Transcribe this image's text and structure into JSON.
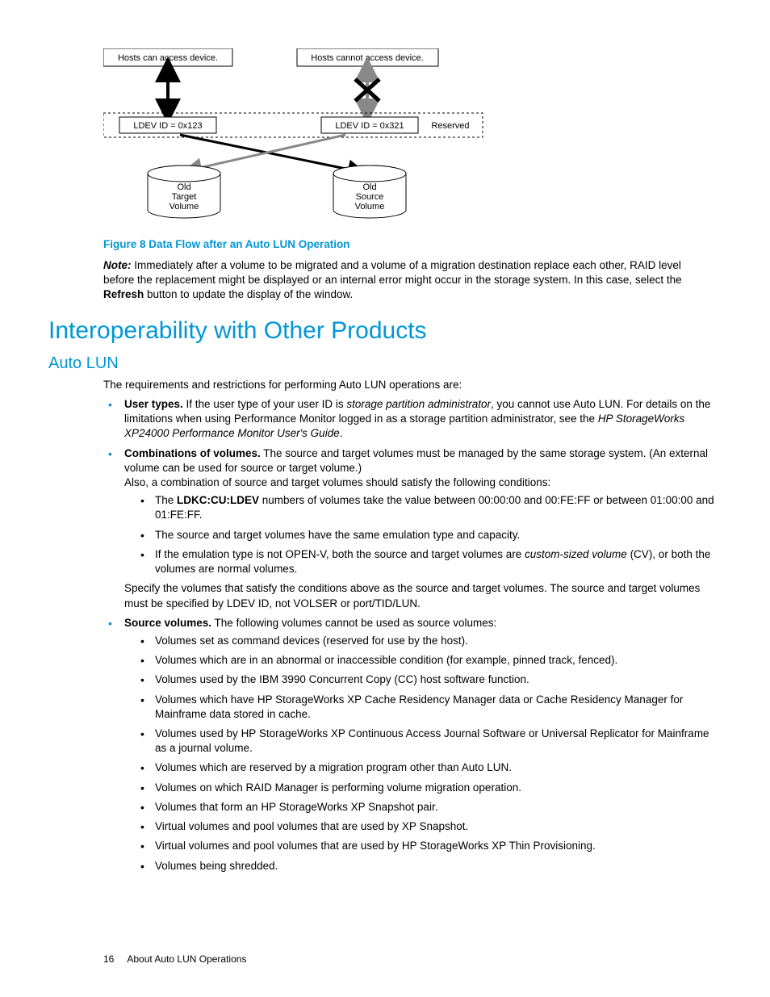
{
  "diagram": {
    "box_hosts_can": "Hosts can access device.",
    "box_hosts_cannot": "Hosts cannot access device.",
    "ldev_left": "LDEV ID = 0x123",
    "ldev_right": "LDEV ID = 0x321",
    "reserved": "Reserved",
    "cyl_left_l1": "Old",
    "cyl_left_l2": "Target",
    "cyl_left_l3": "Volume",
    "cyl_right_l1": "Old",
    "cyl_right_l2": "Source",
    "cyl_right_l3": "Volume"
  },
  "figure_caption": "Figure 8 Data Flow after an Auto LUN Operation",
  "note": {
    "label": "Note:",
    "text_a": " Immediately after a volume to be migrated and a volume of a migration destination replace each other, RAID level before the replacement might be displayed or an internal error might occur in the storage system. In this case, select the ",
    "refresh": "Refresh",
    "text_b": " button to update the display of the window."
  },
  "h1": "Interoperability with Other Products",
  "h2": "Auto LUN",
  "intro": "The requirements and restrictions for performing Auto LUN operations are:",
  "li1": {
    "lead": "User types.",
    "t1": " If the user type of your user ID is ",
    "i1": "storage partition administrator",
    "t2": ", you cannot use Auto LUN. For details on the limitations when using Performance Monitor logged in as a storage partition administrator, see the ",
    "i2": "HP StorageWorks XP24000 Performance Monitor User's Guide",
    "t3": "."
  },
  "li2": {
    "lead": "Combinations of volumes.",
    "t1": " The source and target volumes must be managed by the same storage system. (An external volume can be used for source or target volume.)",
    "t2": "Also, a combination of source and target volumes should satisfy the following conditions:",
    "sub1_a": "The ",
    "sub1_b": "LDKC:CU:LDEV",
    "sub1_c": " numbers of volumes take the value between 00:00:00 and 00:FE:FF or between 01:00:00 and 01:FE:FF.",
    "sub2": "The source and target volumes have the same emulation type and capacity.",
    "sub3_a": "If the emulation type is not OPEN-V, both the source and target volumes are ",
    "sub3_b": "custom-sized volume",
    "sub3_c": " (CV), or both the volumes are normal volumes.",
    "post": "Specify the volumes that satisfy the conditions above as the source and target volumes. The source and target volumes must be specified by LDEV ID, not VOLSER or port/TID/LUN."
  },
  "li3": {
    "lead": "Source volumes.",
    "t1": " The following volumes cannot be used as source volumes:",
    "sub1": "Volumes set as command devices (reserved for use by the host).",
    "sub2": "Volumes which are in an abnormal or inaccessible condition (for example, pinned track, fenced).",
    "sub3": "Volumes used by the IBM 3990 Concurrent Copy (CC) host software function.",
    "sub4": "Volumes which have HP StorageWorks XP Cache Residency Manager data or Cache Residency Manager for Mainframe data stored in cache.",
    "sub5": "Volumes used by HP StorageWorks XP Continuous Access Journal Software or Universal Replicator for Mainframe as a journal volume.",
    "sub6": "Volumes which are reserved by a migration program other than Auto LUN.",
    "sub7": "Volumes on which RAID Manager is performing volume migration operation.",
    "sub8": "Volumes that form an HP StorageWorks XP Snapshot pair.",
    "sub9": "Virtual volumes and pool volumes that are used by XP Snapshot.",
    "sub10": "Virtual volumes and pool volumes that are used by HP StorageWorks XP Thin Provisioning.",
    "sub11": "Volumes being shredded."
  },
  "footer": {
    "page": "16",
    "section": "About Auto LUN Operations"
  }
}
